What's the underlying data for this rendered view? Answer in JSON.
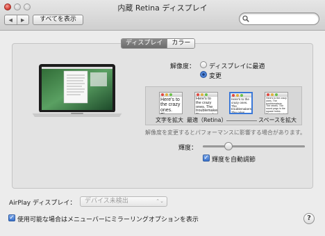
{
  "window": {
    "title": "内蔵 Retina ディスプレイ"
  },
  "toolbar": {
    "back_icon": "back-arrow-icon",
    "forward_icon": "forward-arrow-icon",
    "back_glyph": "◀",
    "forward_glyph": "▶",
    "show_all_label": "すべてを表示",
    "search_value": "",
    "search_icon": "search-icon"
  },
  "tabs": [
    {
      "label": "ディスプレイ",
      "selected": true
    },
    {
      "label": "カラー",
      "selected": false
    }
  ],
  "resolution": {
    "label": "解像度：",
    "options": [
      {
        "label": "ディスプレイに最適",
        "selected": false
      },
      {
        "label": "変更",
        "selected": true
      }
    ],
    "scales": [
      {
        "label": "文字を拡大",
        "sample": "Here's to the crazy ones. The troublemakers."
      },
      {
        "label": "最適（Retina）",
        "sample": "Here's to the crazy ones. The troublemakers. The round pegs."
      },
      {
        "label": "",
        "sample": "Here's to the crazy ones. The troublemakers. The rules. And they have no respect."
      },
      {
        "label": "スペースを拡大",
        "sample": "Here's to the crazy ones. The troublemakers. The rebels. The round pegs in the square holes. They're not fond of rules."
      }
    ],
    "selected_scale_index": 2,
    "hint": "解像度を変更するとパフォーマンスに影響する場合があります。"
  },
  "brightness": {
    "label": "輝度：",
    "level": 0.25,
    "auto_label": "輝度を自動調節",
    "auto_checked": true
  },
  "airplay": {
    "label": "AirPlay ディスプレイ：",
    "selected": "デバイス未検出",
    "show_mirroring_label": "使用可能な場合はメニューバーにミラーリングオプションを表示",
    "show_mirroring_checked": true
  },
  "help_glyph": "?",
  "check_glyph": "✓",
  "popup_arrows": "⌃⌄",
  "colors": {
    "accent": "#3a78d8",
    "close": "#d9433a",
    "selected_tab": "#777777"
  }
}
